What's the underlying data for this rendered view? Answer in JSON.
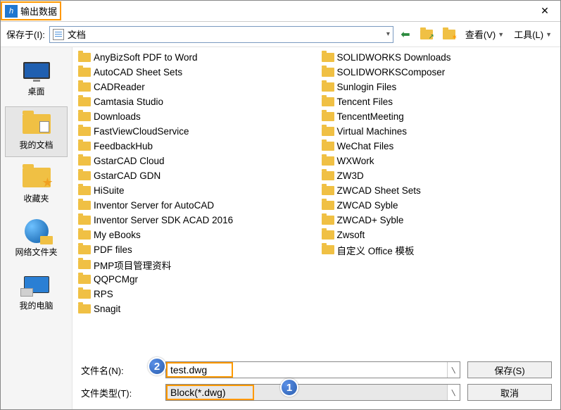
{
  "title": "输出数据",
  "close_glyph": "✕",
  "toolbar": {
    "save_in_label": "保存于(I):",
    "save_in_value": "文档",
    "view_label": "查看(V)",
    "tools_label": "工具(L)"
  },
  "sidebar": [
    {
      "key": "desktop",
      "label": "桌面"
    },
    {
      "key": "mydocs",
      "label": "我的文档"
    },
    {
      "key": "favorites",
      "label": "收藏夹"
    },
    {
      "key": "network",
      "label": "网络文件夹"
    },
    {
      "key": "mycomputer",
      "label": "我的电脑"
    }
  ],
  "files_col1": [
    "AnyBizSoft PDF to Word",
    "AutoCAD Sheet Sets",
    "CADReader",
    "Camtasia Studio",
    "Downloads",
    "FastViewCloudService",
    "FeedbackHub",
    "GstarCAD Cloud",
    "GstarCAD GDN",
    "HiSuite",
    "Inventor Server for AutoCAD",
    "Inventor Server SDK ACAD 2016",
    "My eBooks",
    "PDF files",
    "PMP项目管理资料",
    "QQPCMgr",
    "RPS",
    "Snagit"
  ],
  "files_col2": [
    "SOLIDWORKS Downloads",
    "SOLIDWORKSComposer",
    "Sunlogin Files",
    "Tencent Files",
    "TencentMeeting",
    "Virtual Machines",
    "WeChat Files",
    "WXWork",
    "ZW3D",
    "ZWCAD Sheet Sets",
    "ZWCAD Syble",
    "ZWCAD+ Syble",
    "Zwsoft",
    "自定义 Office 模板"
  ],
  "bottom": {
    "filename_label": "文件名(N):",
    "filename_value": "test.dwg",
    "filetype_label": "文件类型(T):",
    "filetype_value": "Block(*.dwg)",
    "save_label": "保存(S)",
    "cancel_label": "取消"
  },
  "callouts": {
    "c1": "1",
    "c2": "2"
  }
}
